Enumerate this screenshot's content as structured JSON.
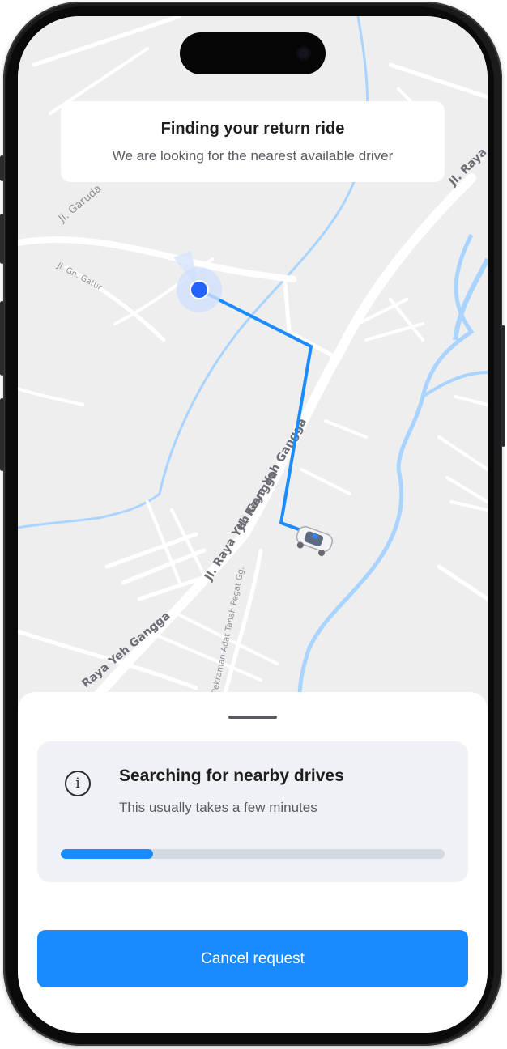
{
  "map": {
    "street_labels": [
      "Jl. Garuda",
      "Jl. Gn. Gatur",
      "Jl. Raya Yeh Gangga",
      "Jl. Raya Yeh Gangga",
      "Raya Yeh Gangga",
      "Jl. Raya",
      "Pekraman Adat Tanah Pegat Gg."
    ],
    "route_color": "#1a8cff",
    "pickup_color": "#2563ff",
    "water_color": "#a9d4ff"
  },
  "status_card": {
    "title": "Finding your return ride",
    "subtitle": "We are looking for the nearest available driver"
  },
  "search_panel": {
    "icon": "info-icon",
    "title": "Searching for nearby drives",
    "subtitle": "This usually takes a few minutes",
    "progress_percent": 24
  },
  "actions": {
    "cancel_label": "Cancel request"
  },
  "colors": {
    "accent": "#1a8cff",
    "progress_track": "#d3d9e3"
  }
}
